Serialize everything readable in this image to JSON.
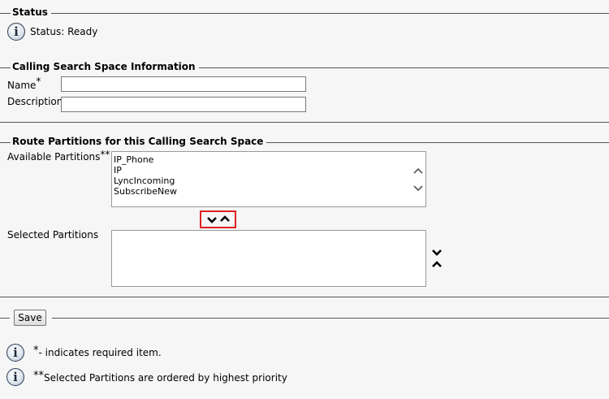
{
  "status": {
    "legend": "Status",
    "text": "Status: Ready"
  },
  "css_info": {
    "legend": "Calling Search Space Information",
    "name_label": "Name",
    "name_marker": "*",
    "name_value": "",
    "description_label": "Description",
    "description_value": ""
  },
  "partitions": {
    "legend": "Route Partitions for this Calling Search Space",
    "available_label": "Available Partitions",
    "available_marker": "**",
    "available_items": [
      "IP_Phone",
      "IP",
      "LyncIncoming",
      "SubscribeNew"
    ],
    "selected_label": "Selected Partitions",
    "selected_items": []
  },
  "actions": {
    "save_label": "Save"
  },
  "notes": {
    "required_marker": "*",
    "required_text": "- indicates required item.",
    "priority_marker": "**",
    "priority_text": "Selected Partitions are ordered by highest priority"
  },
  "icons": {
    "info": "info-icon",
    "move_down": "chevron-down-icon",
    "move_up": "chevron-up-icon"
  },
  "colors": {
    "highlight_border": "#e02020",
    "background": "#f6f6f6"
  }
}
